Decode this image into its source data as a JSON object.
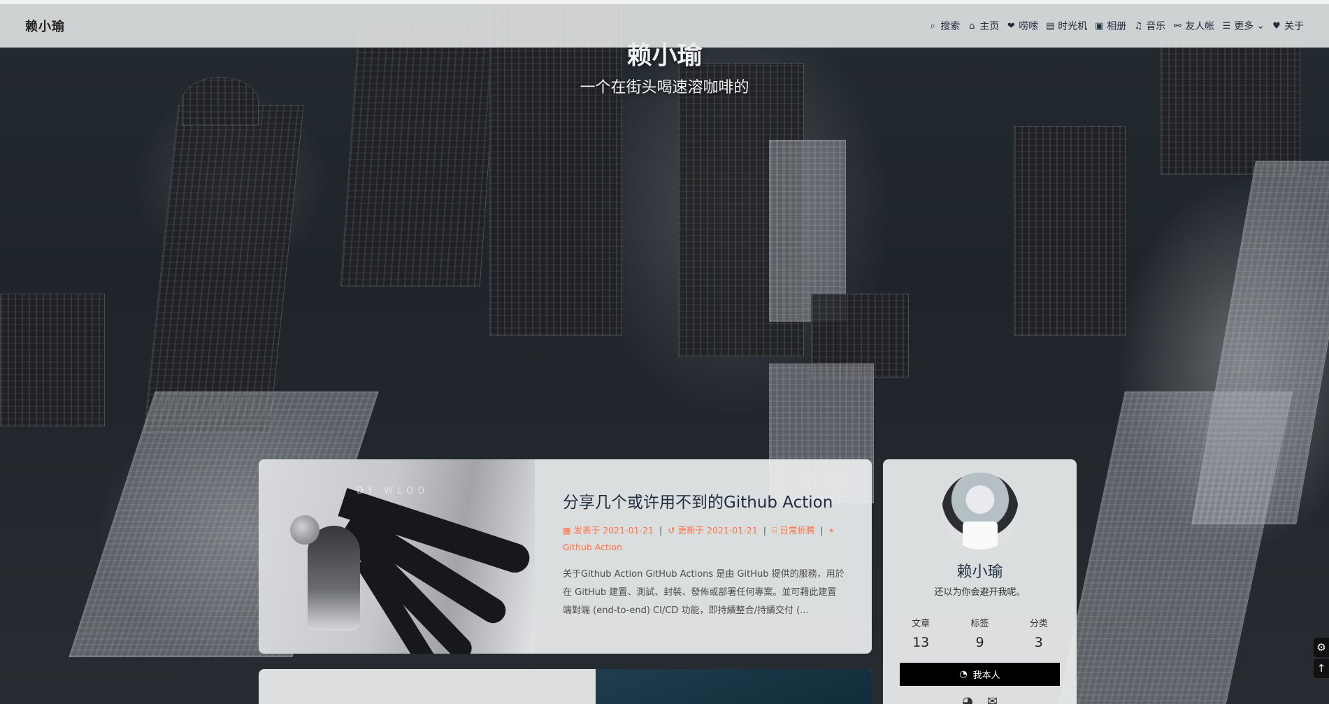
{
  "navbar": {
    "brand": "赖小瑜",
    "menu": [
      {
        "icon": "search-icon",
        "glyph": "⌕",
        "label": "搜索"
      },
      {
        "icon": "home-icon",
        "glyph": "⌂",
        "label": "主页"
      },
      {
        "icon": "heart-comment-icon",
        "glyph": "❤",
        "label": "唠嗦"
      },
      {
        "icon": "archive-icon",
        "glyph": "▤",
        "label": "时光机"
      },
      {
        "icon": "image-icon",
        "glyph": "▣",
        "label": "相册"
      },
      {
        "icon": "music-icon",
        "glyph": "♫",
        "label": "音乐"
      },
      {
        "icon": "link-icon",
        "glyph": "⚯",
        "label": "友人帐"
      },
      {
        "icon": "list-icon",
        "glyph": "☰",
        "label": "更多",
        "chevron": "⌄"
      },
      {
        "icon": "heart-icon",
        "glyph": "♥",
        "label": "关于"
      }
    ]
  },
  "hero": {
    "title": "赖小瑜",
    "subtitle": "一个在街头喝速溶咖啡的"
  },
  "post": {
    "title": "分享几个或许用不到的Github Action",
    "cover_text": "DY WLOD",
    "meta": {
      "posted_label": "发表于 2021-01-21",
      "updated_label": "更新于 2021-01-21",
      "category": "日常折腾",
      "tag": "Github Action",
      "separator": "|"
    },
    "excerpt": "关于Github Action GitHub Actions 是由 GitHub 提供的服務，用於在 GitHub 建置、測試、封裝、發佈或部署任何專案。並可藉此建置端對端 (end-to-end) CI/CD 功能，即持續整合/持續交付 (..."
  },
  "author": {
    "name": "赖小瑜",
    "description": "还以为你会避开我呢。",
    "stats": [
      {
        "label": "文章",
        "value": "13"
      },
      {
        "label": "标签",
        "value": "9"
      },
      {
        "label": "分类",
        "value": "3"
      }
    ],
    "follow_label": "我本人",
    "social": [
      "github-icon",
      "email-icon"
    ]
  },
  "float_buttons": [
    {
      "icon": "gear-icon",
      "glyph": "⚙"
    },
    {
      "icon": "arrow-up-icon",
      "glyph": "↑"
    }
  ]
}
